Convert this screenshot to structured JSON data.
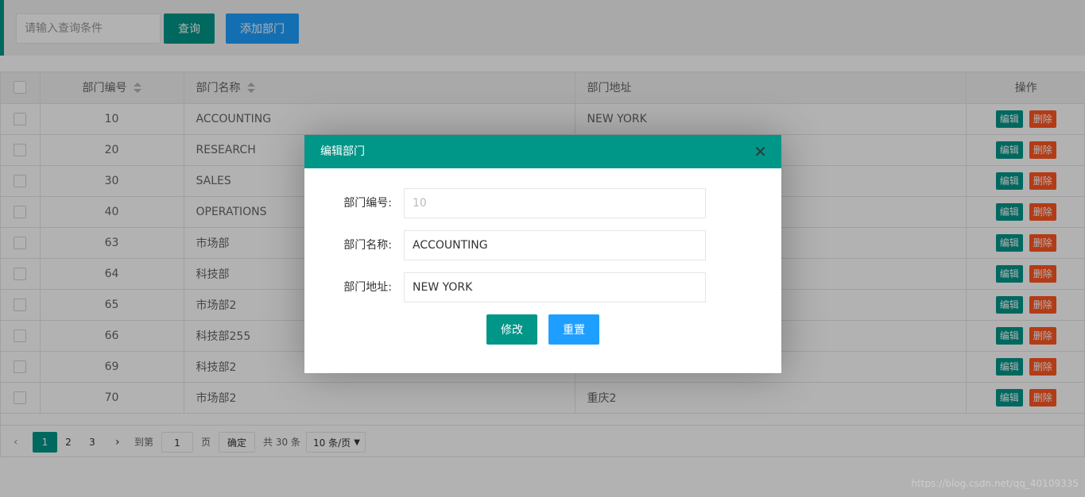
{
  "toolbar": {
    "search_placeholder": "请输入查询条件",
    "query_label": "查询",
    "add_label": "添加部门"
  },
  "table": {
    "headers": [
      "部门编号",
      "部门名称",
      "部门地址",
      "操作"
    ],
    "edit_label": "编辑",
    "delete_label": "删除",
    "rows": [
      {
        "no": "10",
        "name": "ACCOUNTING",
        "addr": "NEW YORK"
      },
      {
        "no": "20",
        "name": "RESEARCH",
        "addr": ""
      },
      {
        "no": "30",
        "name": "SALES",
        "addr": ""
      },
      {
        "no": "40",
        "name": "OPERATIONS",
        "addr": ""
      },
      {
        "no": "63",
        "name": "市场部",
        "addr": ""
      },
      {
        "no": "64",
        "name": "科技部",
        "addr": ""
      },
      {
        "no": "65",
        "name": "市场部2",
        "addr": ""
      },
      {
        "no": "66",
        "name": "科技部255",
        "addr": ""
      },
      {
        "no": "69",
        "name": "科技部2",
        "addr": ""
      },
      {
        "no": "70",
        "name": "市场部2",
        "addr": "重庆2"
      }
    ]
  },
  "pager": {
    "prev": "‹",
    "next": "›",
    "pages": [
      "1",
      "2",
      "3"
    ],
    "goto_label": "到第",
    "goto_value": "1",
    "page_unit": "页",
    "confirm_label": "确定",
    "total": "共 30 条",
    "page_size": "10 条/页"
  },
  "modal": {
    "title": "编辑部门",
    "close": "✕",
    "fields": [
      {
        "label": "部门编号:",
        "value": "10"
      },
      {
        "label": "部门名称:",
        "value": "ACCOUNTING"
      },
      {
        "label": "部门地址:",
        "value": "NEW YORK"
      }
    ],
    "modify_label": "修改",
    "reset_label": "重置"
  },
  "watermark": "https://blog.csdn.net/qq_40109335"
}
